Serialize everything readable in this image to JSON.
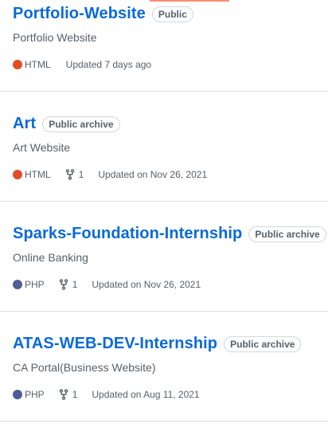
{
  "repos": [
    {
      "name": "Portfolio-Website",
      "visibility": "Public",
      "description": "Portfolio Website",
      "language": "HTML",
      "language_color": "#e34c26",
      "forks": null,
      "updated": "Updated 7 days ago"
    },
    {
      "name": "Art",
      "visibility": "Public archive",
      "description": "Art Website",
      "language": "HTML",
      "language_color": "#e34c26",
      "forks": "1",
      "updated": "Updated on Nov 26, 2021"
    },
    {
      "name": "Sparks-Foundation-Internship",
      "visibility": "Public archive",
      "description": "Online Banking",
      "language": "PHP",
      "language_color": "#4F5D95",
      "forks": "1",
      "updated": "Updated on Nov 26, 2021"
    },
    {
      "name": "ATAS-WEB-DEV-Internship",
      "visibility": "Public archive",
      "description": "CA Portal(Business Website)",
      "language": "PHP",
      "language_color": "#4F5D95",
      "forks": "1",
      "updated": "Updated on Aug 11, 2021"
    }
  ],
  "icons": {
    "fork": "repo-forked-icon",
    "language": "language-color-dot"
  },
  "colors": {
    "link": "#0969da",
    "muted": "#57606a",
    "border": "#d0d7de",
    "accent": "#fd8c73"
  }
}
